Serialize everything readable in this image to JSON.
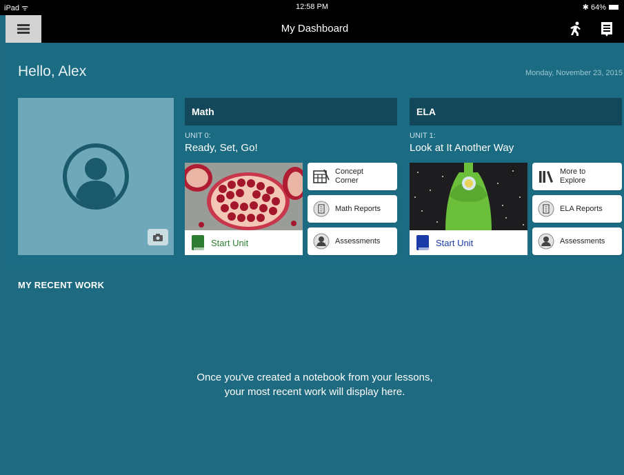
{
  "status_bar": {
    "left": "iPad ᯤ",
    "time": "12:58 PM",
    "battery": "✱ 64%"
  },
  "header": {
    "title": "My Dashboard",
    "icons": [
      "menu-icon",
      "activity-icon",
      "notes-icon"
    ]
  },
  "greeting": "Hello, Alex",
  "date": "Monday, November 23, 2015",
  "profile": {
    "icons": [
      "avatar-icon",
      "camera-icon"
    ]
  },
  "subjects": [
    {
      "name": "Math",
      "unit_label": "UNIT 0:",
      "unit_title": "Ready, Set, Go!",
      "start_label": "Start Unit",
      "book_color": "#2e7d32",
      "start_text_color": "#2e7d32",
      "buttons": [
        {
          "label_line1": "Concept",
          "label_line2": "Corner",
          "icon": "calculator-icon"
        },
        {
          "label_line1": "Math Reports",
          "label_line2": "",
          "icon": "report-icon"
        },
        {
          "label_line1": "Assessments",
          "label_line2": "",
          "icon": "person-icon"
        }
      ]
    },
    {
      "name": "ELA",
      "unit_label": "UNIT 1:",
      "unit_title": "Look at It Another Way",
      "start_label": "Start Unit",
      "book_color": "#1a3aa8",
      "start_text_color": "#1a3aa8",
      "buttons": [
        {
          "label_line1": "More to",
          "label_line2": "Explore",
          "icon": "library-icon"
        },
        {
          "label_line1": "ELA Reports",
          "label_line2": "",
          "icon": "report-icon"
        },
        {
          "label_line1": "Assessments",
          "label_line2": "",
          "icon": "person-icon"
        }
      ]
    }
  ],
  "recent": {
    "title": "MY RECENT WORK",
    "message_line1": "Once you've created a notebook from your lessons,",
    "message_line2": "your most recent work will display here."
  },
  "colors": {
    "panel": "#1b6b82",
    "header_bar": "#13485a",
    "profile_bg": "#6fa8b8",
    "avatar": "#1b5a6d"
  }
}
